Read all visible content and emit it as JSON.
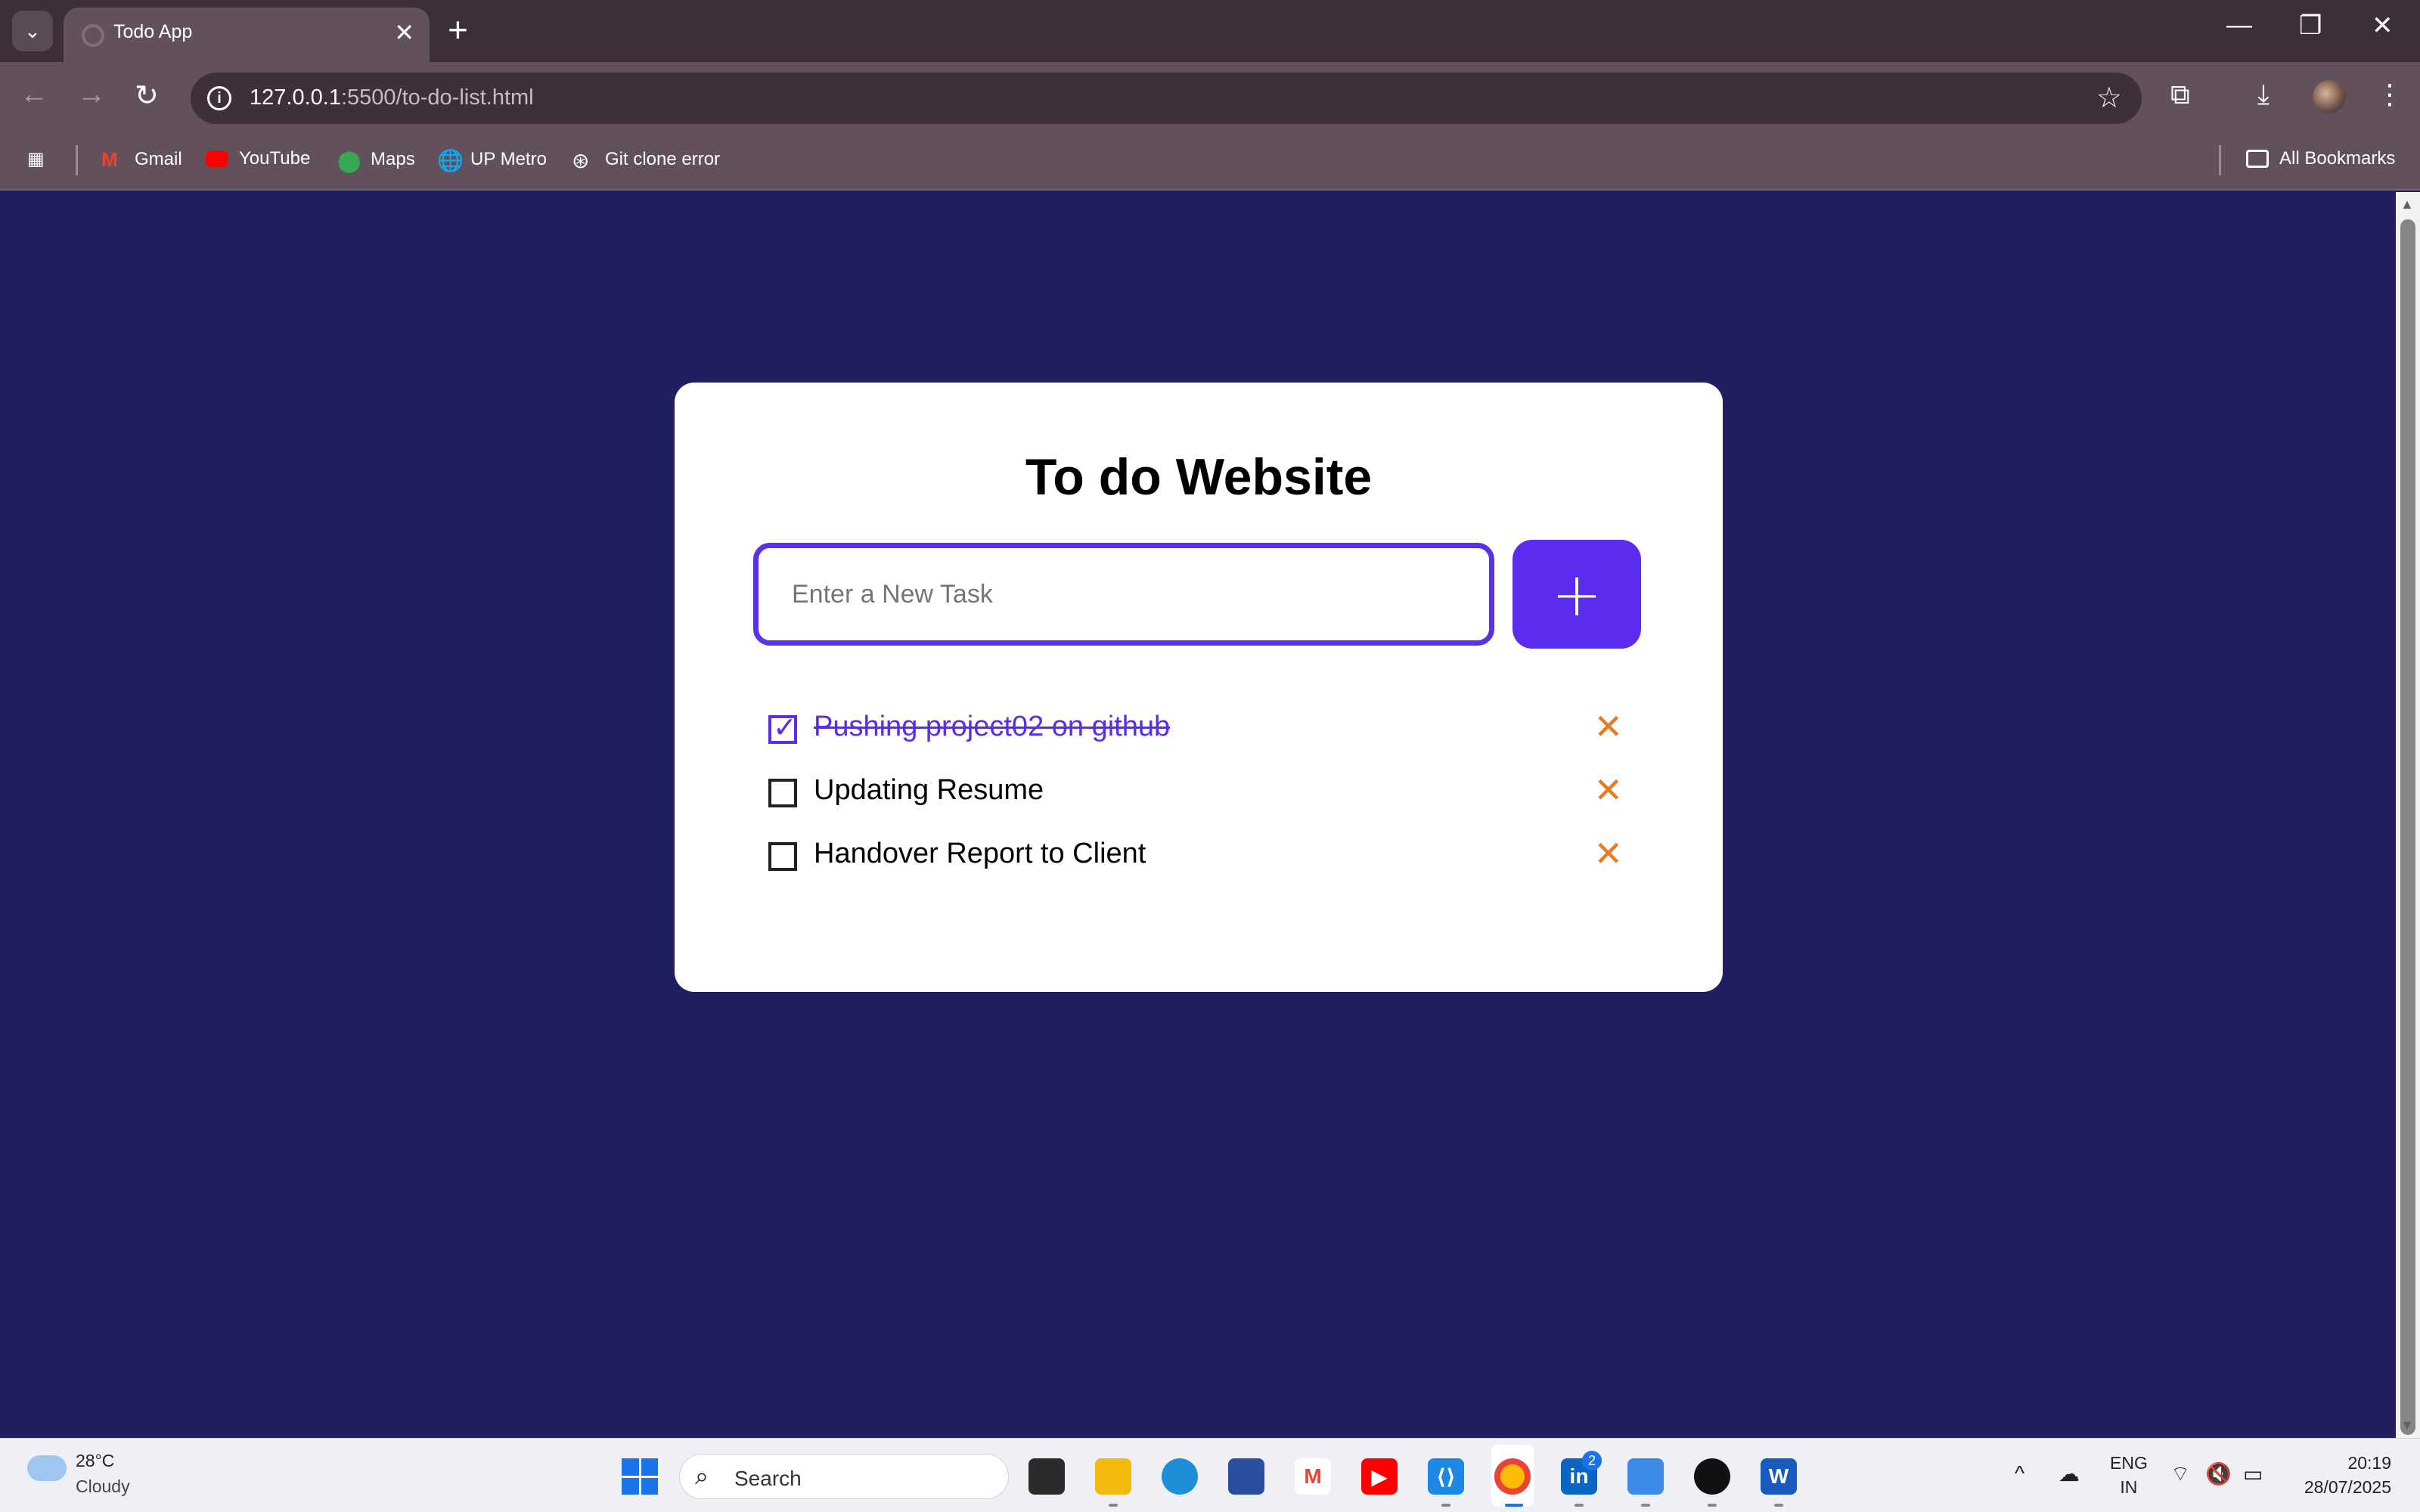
{
  "browser": {
    "tab_title": "Todo App",
    "url_host": "127.0.0.1",
    "url_rest": ":5500/to-do-list.html",
    "bookmarks": [
      "Gmail",
      "YouTube",
      "Maps",
      "UP Metro",
      "Git clone error"
    ],
    "all_bookmarks": "All Bookmarks"
  },
  "app": {
    "title": "To do Website",
    "input_placeholder": "Enter a New Task",
    "add_label": "+",
    "delete_label": "✕",
    "tasks": [
      {
        "text": "Pushing project02 on github",
        "done": true
      },
      {
        "text": "Updating Resume",
        "done": false
      },
      {
        "text": "Handover Report to Client",
        "done": false
      }
    ],
    "colors": {
      "background": "#202060",
      "accent": "#5b2cf0",
      "delete": "#e87c20"
    }
  },
  "taskbar": {
    "weather_temp": "28°C",
    "weather_desc": "Cloudy",
    "search_label": "Search",
    "lang_line1": "ENG",
    "lang_line2": "IN",
    "time": "20:19",
    "date": "28/07/2025",
    "linkedin_badge": "2"
  }
}
